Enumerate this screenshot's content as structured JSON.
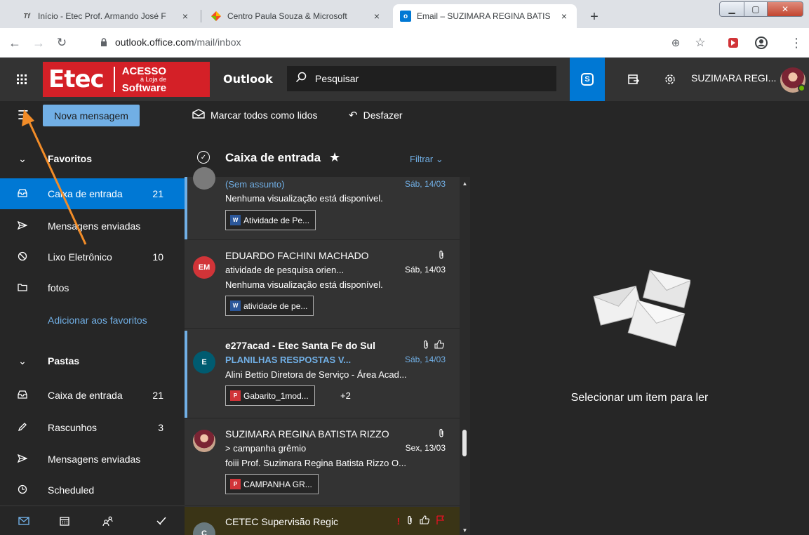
{
  "browser": {
    "tabs": [
      {
        "title": "Início - Etec Prof. Armando José F",
        "close": "×"
      },
      {
        "title": "Centro Paula Souza & Microsoft",
        "close": "×"
      },
      {
        "title": "Email – SUZIMARA REGINA BATIS",
        "close": "×"
      }
    ],
    "url_host": "outlook.office.com",
    "url_path": "/mail/inbox"
  },
  "header": {
    "logo_main": "Etec",
    "logo_line1": "ACESSO",
    "logo_line2": "à Loja de",
    "logo_line3": "Software",
    "app_name": "Outlook",
    "search_placeholder": "Pesquisar",
    "user_name": "SUZIMARA REGI..."
  },
  "commands": {
    "new_message": "Nova mensagem",
    "mark_all_read": "Marcar todos como lidos",
    "undo": "Desfazer"
  },
  "nav": {
    "favorites_header": "Favoritos",
    "favorites": [
      {
        "label": "Caixa de entrada",
        "count": "21",
        "icon": "inbox-icon"
      },
      {
        "label": "Mensagens enviadas",
        "count": "",
        "icon": "send-icon"
      },
      {
        "label": "Lixo Eletrônico",
        "count": "10",
        "icon": "junk-icon"
      },
      {
        "label": "fotos",
        "count": "",
        "icon": "folder-icon"
      }
    ],
    "add_favorites": "Adicionar aos favoritos",
    "folders_header": "Pastas",
    "folders": [
      {
        "label": "Caixa de entrada",
        "count": "21",
        "icon": "inbox-icon"
      },
      {
        "label": "Rascunhos",
        "count": "3",
        "icon": "pencil-icon"
      },
      {
        "label": "Mensagens enviadas",
        "count": "",
        "icon": "send-icon"
      },
      {
        "label": "Scheduled",
        "count": "",
        "icon": "clock-icon"
      }
    ]
  },
  "list": {
    "title": "Caixa de entrada",
    "filter": "Filtrar",
    "messages": [
      {
        "sender": "",
        "subject": "(Sem assunto)",
        "date": "Sáb, 14/03",
        "preview": "Nenhuma visualização está disponível.",
        "attachment": "Atividade de Pe...",
        "initials": ""
      },
      {
        "sender": "EDUARDO FACHINI MACHADO",
        "subject": "atividade de pesquisa orien...",
        "date": "Sáb, 14/03",
        "preview": "Nenhuma visualização está disponível.",
        "attachment": "atividade de pe...",
        "initials": "EM"
      },
      {
        "sender": "e277acad - Etec Santa Fe do Sul",
        "subject": "PLANILHAS RESPOSTAS V...",
        "date": "Sáb, 14/03",
        "preview": "Alini Bettio Diretora de Serviço - Área Acad...",
        "attachment": "Gabarito_1mod...",
        "extra": "+2",
        "initials": "E"
      },
      {
        "sender": "SUZIMARA REGINA BATISTA RIZZO",
        "subject": "> campanha grêmio",
        "date": "Sex, 13/03",
        "preview": "foiii Prof. Suzimara Regina Batista Rizzo O...",
        "attachment": "CAMPANHA GR...",
        "initials": ""
      },
      {
        "sender": "CETEC Supervisão Regic",
        "initials": "C",
        "flag_text": "!"
      }
    ]
  },
  "reading_pane": {
    "empty_text": "Selecionar um item para ler"
  },
  "colors": {
    "accent": "#0078d4",
    "link": "#71afe5",
    "logo_red": "#d42027",
    "annotation": "#f28c28"
  }
}
